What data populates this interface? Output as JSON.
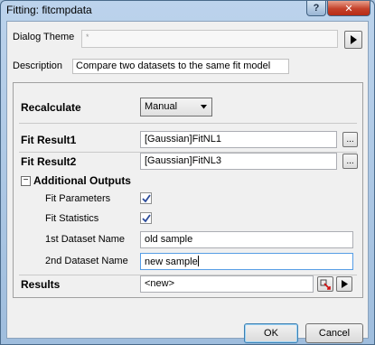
{
  "window": {
    "title": "Fitting: fitcmpdata",
    "help_label": "?",
    "close_label": "✕"
  },
  "theme": {
    "label": "Dialog Theme",
    "value": "*"
  },
  "description": {
    "label": "Description",
    "value": "Compare two datasets to the same fit model"
  },
  "recalculate": {
    "label": "Recalculate",
    "selected": "Manual"
  },
  "fit_result1": {
    "label": "Fit Result1",
    "value": "[Gaussian]FitNL1",
    "browse_label": "..."
  },
  "fit_result2": {
    "label": "Fit Result2",
    "value": "[Gaussian]FitNL3",
    "browse_label": "..."
  },
  "additional_outputs": {
    "label": "Additional Outputs",
    "expander": "−",
    "fit_parameters": {
      "label": "Fit Parameters",
      "checked": true
    },
    "fit_statistics": {
      "label": "Fit Statistics",
      "checked": true
    },
    "dataset1_name": {
      "label": "1st Dataset Name",
      "value": "old sample"
    },
    "dataset2_name": {
      "label": "2nd Dataset Name",
      "value": "new sample"
    }
  },
  "results": {
    "label": "Results",
    "value": "<new>"
  },
  "footer": {
    "ok_label": "OK",
    "cancel_label": "Cancel"
  }
}
